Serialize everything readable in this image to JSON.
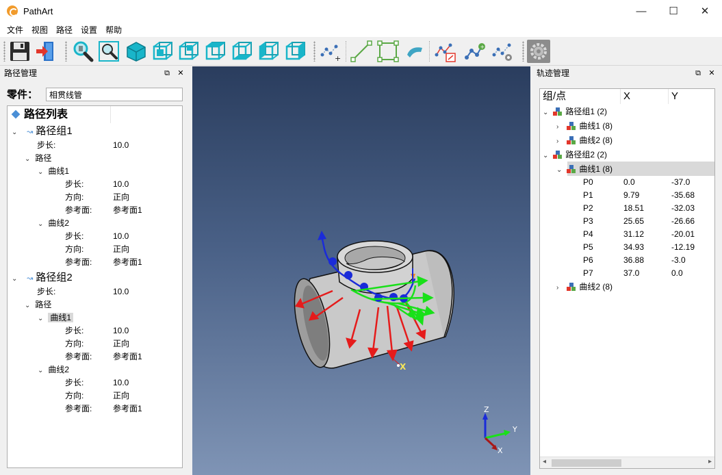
{
  "window": {
    "title": "PathArt"
  },
  "menu": [
    "文件",
    "视图",
    "路径",
    "设置",
    "帮助"
  ],
  "toolbar": {
    "icons": [
      "save-icon",
      "exit-icon",
      "zoom-icon",
      "zoom-fit-icon",
      "solid-cube-icon",
      "front-view-icon",
      "back-view-icon",
      "top-view-icon",
      "bottom-view-icon",
      "left-view-icon",
      "right-view-icon",
      "add-path-icon",
      "line-icon",
      "rectangle-icon",
      "surface-icon",
      "edit-path-icon",
      "path-node-icon",
      "path-check-icon",
      "settings-gear-icon"
    ]
  },
  "left_panel": {
    "title": "路径管理",
    "part_label": "零件：",
    "part_value": "相贯线管",
    "tree_header": "路径列表",
    "groups": [
      {
        "name": "路径组1",
        "step_label": "步长:",
        "step_value": "10.0",
        "path_label": "路径",
        "curves": [
          {
            "name": "曲线1",
            "step_label": "步长:",
            "step_value": "10.0",
            "dir_label": "方向:",
            "dir_value": "正向",
            "ref_label": "参考面:",
            "ref_value": "参考面1"
          },
          {
            "name": "曲线2",
            "step_label": "步长:",
            "step_value": "10.0",
            "dir_label": "方向:",
            "dir_value": "正向",
            "ref_label": "参考面:",
            "ref_value": "参考面1"
          }
        ]
      },
      {
        "name": "路径组2",
        "step_label": "步长:",
        "step_value": "10.0",
        "path_label": "路径",
        "curves": [
          {
            "name": "曲线1",
            "step_label": "步长:",
            "step_value": "10.0",
            "dir_label": "方向:",
            "dir_value": "正向",
            "ref_label": "参考面:",
            "ref_value": "参考面1"
          },
          {
            "name": "曲线2",
            "step_label": "步长:",
            "step_value": "10.0",
            "dir_label": "方向:",
            "dir_value": "正向",
            "ref_label": "参考面:",
            "ref_value": "参考面1"
          }
        ]
      }
    ]
  },
  "viewport": {
    "axis_labels": {
      "x": "X",
      "y": "Y",
      "z": "Z"
    },
    "marker_label": "X"
  },
  "right_panel": {
    "title": "轨迹管理",
    "columns": [
      "组/点",
      "X",
      "Y"
    ],
    "rows": {
      "g1": "路径组1 (2)",
      "g1c1": "曲线1 (8)",
      "g1c2": "曲线2 (8)",
      "g2": "路径组2 (2)",
      "g2c1": "曲线1 (8)",
      "g2c2": "曲线2 (8)"
    },
    "points": [
      {
        "name": "P0",
        "x": "0.0",
        "y": "-37.0"
      },
      {
        "name": "P1",
        "x": "9.79",
        "y": "-35.68"
      },
      {
        "name": "P2",
        "x": "18.51",
        "y": "-32.03"
      },
      {
        "name": "P3",
        "x": "25.65",
        "y": "-26.66"
      },
      {
        "name": "P4",
        "x": "31.12",
        "y": "-20.01"
      },
      {
        "name": "P5",
        "x": "34.93",
        "y": "-12.19"
      },
      {
        "name": "P6",
        "x": "36.88",
        "y": "-3.0"
      },
      {
        "name": "P7",
        "x": "37.0",
        "y": "0.0"
      }
    ]
  },
  "colors": {
    "accent_blue": "#0078d7",
    "toolbar_cyan": "#19b5c9",
    "selection": "#d9d9d9",
    "viewport_top": "#2a3d5e",
    "viewport_bottom": "#7f94b5"
  }
}
